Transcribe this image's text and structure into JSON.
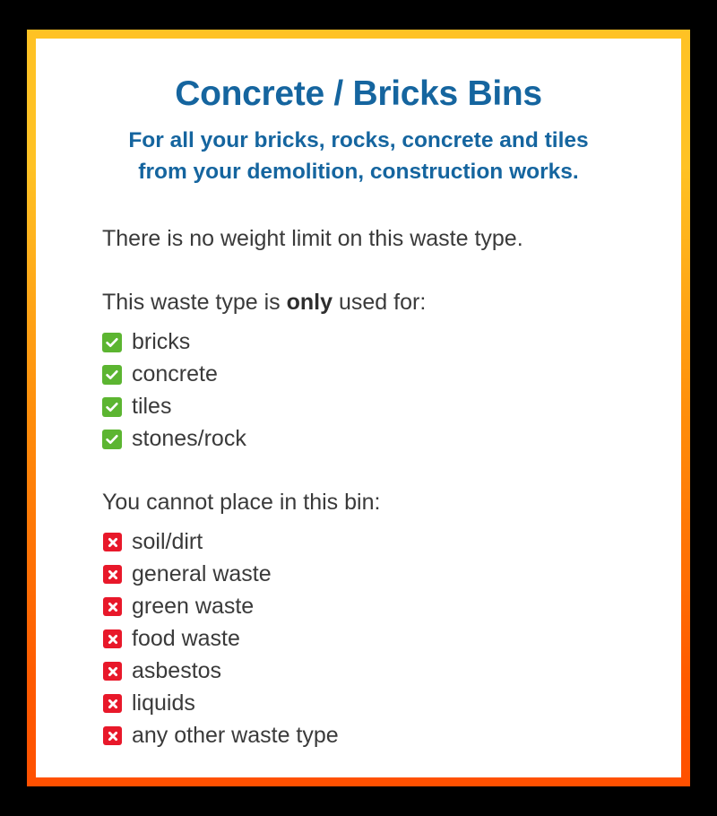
{
  "card": {
    "title": "Concrete / Bricks Bins",
    "subtitle_line1": "For all your bricks, rocks, concrete and tiles",
    "subtitle_line2": "from your demolition, construction works.",
    "weight_note": "There is no weight limit on this waste type.",
    "allowed_intro_prefix": "This waste type is ",
    "allowed_intro_emphasis": "only",
    "allowed_intro_suffix": " used for:",
    "disallowed_intro": "You cannot place in this bin:"
  },
  "allowed": {
    "icon": "check-icon",
    "items": [
      {
        "label": "bricks"
      },
      {
        "label": "concrete"
      },
      {
        "label": "tiles"
      },
      {
        "label": "stones/rock"
      }
    ]
  },
  "disallowed": {
    "icon": "cross-icon",
    "items": [
      {
        "label": "soil/dirt"
      },
      {
        "label": "general waste"
      },
      {
        "label": "green waste"
      },
      {
        "label": "food waste"
      },
      {
        "label": "asbestos"
      },
      {
        "label": "liquids"
      },
      {
        "label": "any other waste type"
      }
    ]
  },
  "colors": {
    "heading_blue": "#15659F",
    "body_text": "#3A3A3A",
    "allowed_green": "#5CB531",
    "disallowed_red": "#E8182A",
    "frame_top": "#FFC224",
    "frame_bottom": "#FF5000",
    "background": "#000000",
    "card_background": "#FFFFFF"
  }
}
